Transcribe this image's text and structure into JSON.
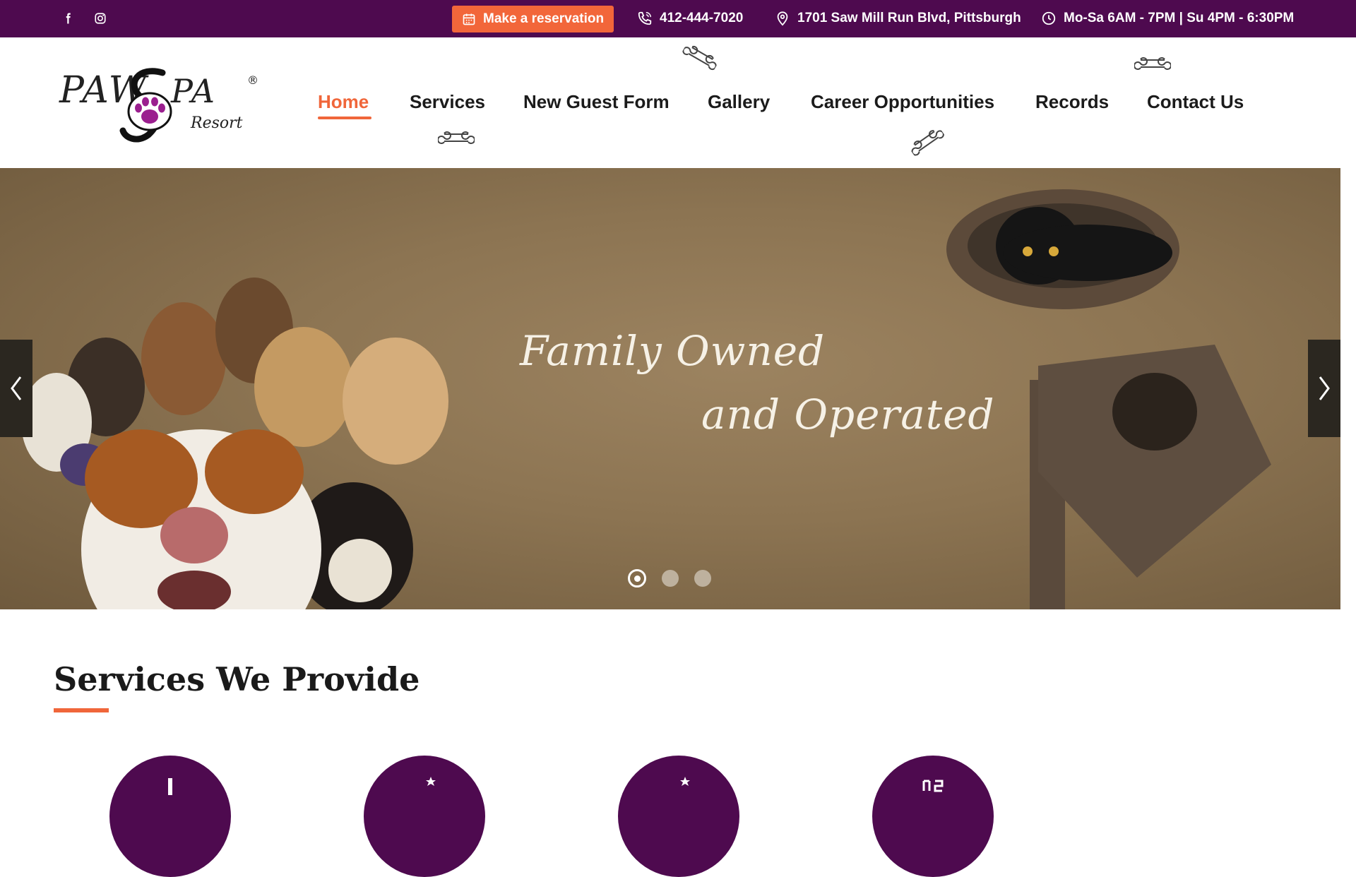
{
  "topbar": {
    "social": [
      {
        "name": "facebook-icon"
      },
      {
        "name": "instagram-icon"
      }
    ],
    "reservation_label": "Make a reservation",
    "phone": "412-444-7020",
    "address": "1701 Saw Mill Run Blvd, Pittsburgh",
    "hours": "Mo-Sa 6AM - 7PM | Su 4PM - 6:30PM"
  },
  "logo": {
    "text_primary": "PAW SPA",
    "text_secondary": "Resort",
    "registered": "®",
    "paw_color": "#9b1f8f"
  },
  "nav": {
    "items": [
      {
        "label": "Home",
        "active": true
      },
      {
        "label": "Services"
      },
      {
        "label": "New Guest Form"
      },
      {
        "label": "Gallery"
      },
      {
        "label": "Career Opportunities"
      },
      {
        "label": "Records"
      },
      {
        "label": "Contact Us"
      }
    ]
  },
  "hero": {
    "caption_line1": "Family Owned",
    "caption_line2": "and Operated",
    "slide_count": 3,
    "active_slide": 1
  },
  "services": {
    "title": "Services We Provide"
  },
  "colors": {
    "brand_purple": "#4e0a4f",
    "accent_orange": "#f0663a"
  }
}
